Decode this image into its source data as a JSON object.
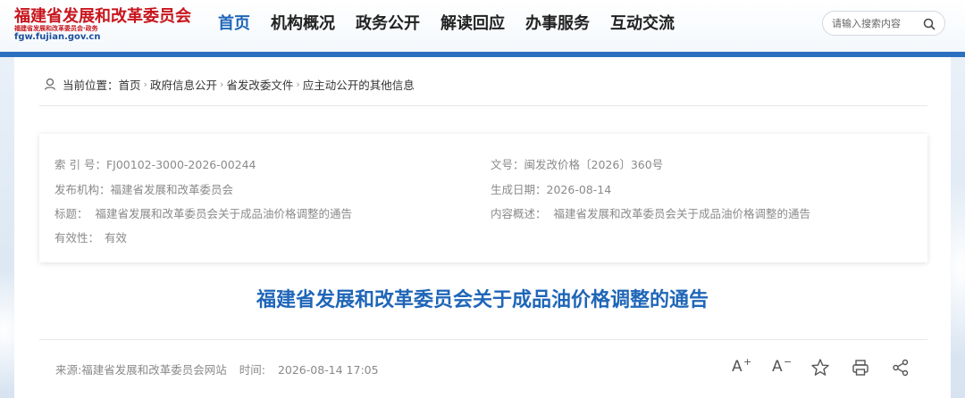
{
  "header": {
    "logo_title": "福建省发展和改革委员会",
    "logo_subtitle": "福建省发展和改革委员会·政务",
    "logo_domain": "fgw.fujian.gov.cn",
    "nav": [
      "首页",
      "机构概况",
      "政务公开",
      "解读回应",
      "办事服务",
      "互动交流"
    ],
    "active_nav": "首页",
    "search_placeholder": "请输入搜索内容"
  },
  "breadcrumb": {
    "prefix": "当前位置：",
    "items": [
      "首页",
      "政府信息公开",
      "省发改委文件",
      "应主动公开的其他信息"
    ],
    "separator": "›"
  },
  "meta": {
    "index_label": "索 引 号：",
    "index_value": "FJ00102-3000-2026-00244",
    "doc_no_label": "文号：",
    "doc_no_value": "闽发改价格〔2026〕360号",
    "publisher_label": "发布机构：",
    "publisher_value": "福建省发展和改革委员会",
    "date_label": "生成日期：",
    "date_value": "2026-08-14",
    "title_label": "标题：",
    "title_value": "福建省发展和改革委员会关于成品油价格调整的通告",
    "summary_label": "内容概述：",
    "summary_value": "福建省发展和改革委员会关于成品油价格调整的通告",
    "validity_label": "有效性：",
    "validity_value": "有效"
  },
  "article": {
    "title": "福建省发展和改革委员会关于成品油价格调整的通告",
    "source": "来源:福建省发展和改革委员会网站",
    "time_label": "时间:",
    "time_value": "2026-08-14 17:05",
    "font_increase": "A",
    "font_increase_sup": "+",
    "font_decrease": "A",
    "font_decrease_sup": "−"
  },
  "colors": {
    "brand_red": "#c8161d",
    "brand_blue": "#1f66b8",
    "header_bar": "#2b6fc0"
  },
  "icons": [
    "search-icon",
    "location-pin-icon",
    "font-increase-icon",
    "font-decrease-icon",
    "star-icon",
    "print-icon",
    "share-icon"
  ]
}
